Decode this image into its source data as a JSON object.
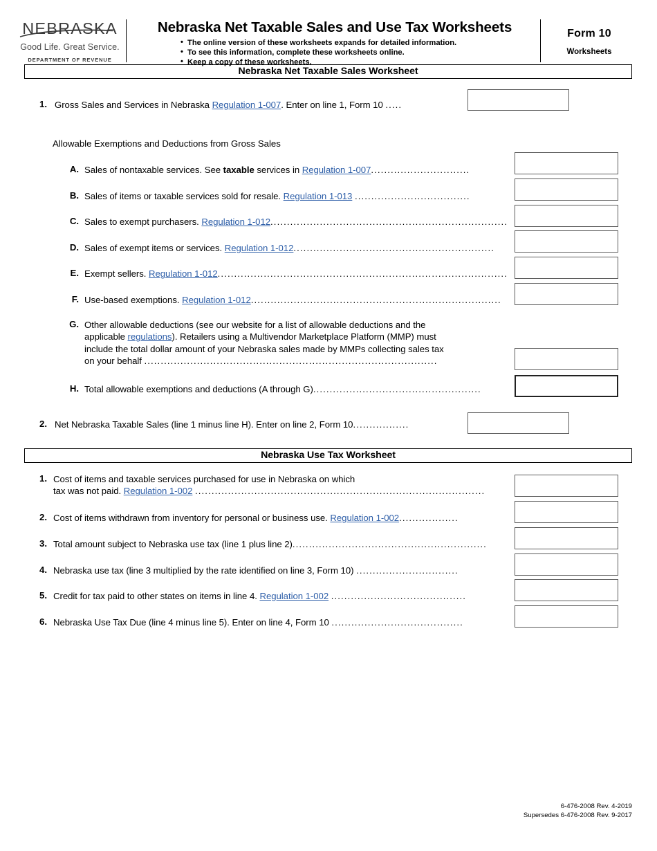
{
  "header": {
    "logo_word": "NEBRASKA",
    "logo_tagline": "Good Life. Great Service.",
    "logo_department": "DEPARTMENT OF REVENUE",
    "title": "Nebraska Net Taxable Sales and Use Tax Worksheets",
    "bullets": [
      "The online version of these worksheets expands for detailed information.",
      "To see this information, complete these worksheets online.",
      "Keep a copy of these worksheets."
    ],
    "form_number": "Form 10",
    "form_subtitle": "Worksheets"
  },
  "sales_worksheet": {
    "banner": "Nebraska Net Taxable Sales Worksheet",
    "line1": {
      "num": "1.",
      "pre": "Gross Sales and Services in Nebraska ",
      "link": "Regulation 1-007",
      "post": ". Enter on line 1, Form 10 ",
      "leader": "....."
    },
    "subheading": "Allowable Exemptions and Deductions from Gross Sales",
    "items": [
      {
        "letter": "A.",
        "pre": "Sales of nontaxable services. See ",
        "bold": "taxable",
        "mid": " services in ",
        "link": "Regulation 1-007",
        "post": "",
        "leader": ".............................."
      },
      {
        "letter": "B.",
        "pre": "Sales of items or taxable services sold for resale. ",
        "bold": "",
        "mid": "",
        "link": "Regulation 1-013",
        "post": " ",
        "leader": "..................................."
      },
      {
        "letter": "C.",
        "pre": "Sales to exempt purchasers. ",
        "bold": "",
        "mid": "",
        "link": "Regulation 1-012",
        "post": "",
        "leader": "........................................................................"
      },
      {
        "letter": "D.",
        "pre": "Sales of exempt items or services. ",
        "bold": "",
        "mid": "",
        "link": "Regulation 1-012",
        "post": "",
        "leader": "............................................................."
      },
      {
        "letter": "E.",
        "pre": "Exempt sellers. ",
        "bold": "",
        "mid": "",
        "link": "Regulation 1-012",
        "post": "",
        "leader": "........................................................................................"
      },
      {
        "letter": "F.",
        "pre": "Use-based exemptions. ",
        "bold": "",
        "mid": "",
        "link": "Regulation 1-012",
        "post": "",
        "leader": "............................................................................"
      }
    ],
    "item_g": {
      "letter": "G.",
      "l1_pre": "Other allowable deductions (see our website for a list of allowable deductions and the",
      "l2_pre": "applicable ",
      "l2_link": "regulations",
      "l2_post": "). Retailers using a Multivendor Marketplace Platform (MMP) must",
      "l3": "include the total dollar amount of your Nebraska sales made by MMPs collecting sales tax",
      "l4": "on your behalf ",
      "l4_leader": "........................................................................................."
    },
    "item_h": {
      "letter": "H.",
      "text": "Total allowable exemptions and deductions (A through G)",
      "leader": "..................................................."
    },
    "line2": {
      "num": "2.",
      "text": "Net Nebraska Taxable Sales (line 1 minus line H). Enter on line 2, Form 10",
      "leader": "................."
    }
  },
  "use_tax_worksheet": {
    "banner": "Nebraska Use Tax Worksheet",
    "lines": [
      {
        "num": "1.",
        "l1": "Cost of items and taxable services purchased for use in Nebraska on which",
        "pre": "tax was not paid. ",
        "link": "Regulation 1-002",
        "post": " ",
        "leader": "........................................................................................"
      },
      {
        "num": "2.",
        "l1": "",
        "pre": "Cost of items withdrawn from inventory for personal or business use. ",
        "link": "Regulation 1-002",
        "post": "",
        "leader": ".................."
      },
      {
        "num": "3.",
        "l1": "",
        "pre": "Total amount subject to Nebraska use tax (line 1 plus line 2)",
        "link": "",
        "post": "",
        "leader": "..........................................................."
      },
      {
        "num": "4.",
        "l1": "",
        "pre": "Nebraska use tax (line 3 multiplied by the rate identified on line 3, Form 10) ",
        "link": "",
        "post": "",
        "leader": "..............................."
      },
      {
        "num": "5.",
        "l1": "",
        "pre": "Credit for tax paid to other states on items in line 4. ",
        "link": "Regulation 1-002",
        "post": " ",
        "leader": "........................................."
      },
      {
        "num": "6.",
        "l1": "",
        "pre": "Nebraska Use Tax Due (line 4 minus line 5). Enter on line 4, Form 10 ",
        "link": "",
        "post": "",
        "leader": "........................................"
      }
    ]
  },
  "footer": {
    "line1": "6-476-2008 Rev. 4-2019",
    "line2": "Supersedes 6-476-2008 Rev. 9-2017"
  },
  "colors": {
    "link": "#2d5ea8",
    "text": "#000000",
    "box_border": "#5a5a5a"
  }
}
